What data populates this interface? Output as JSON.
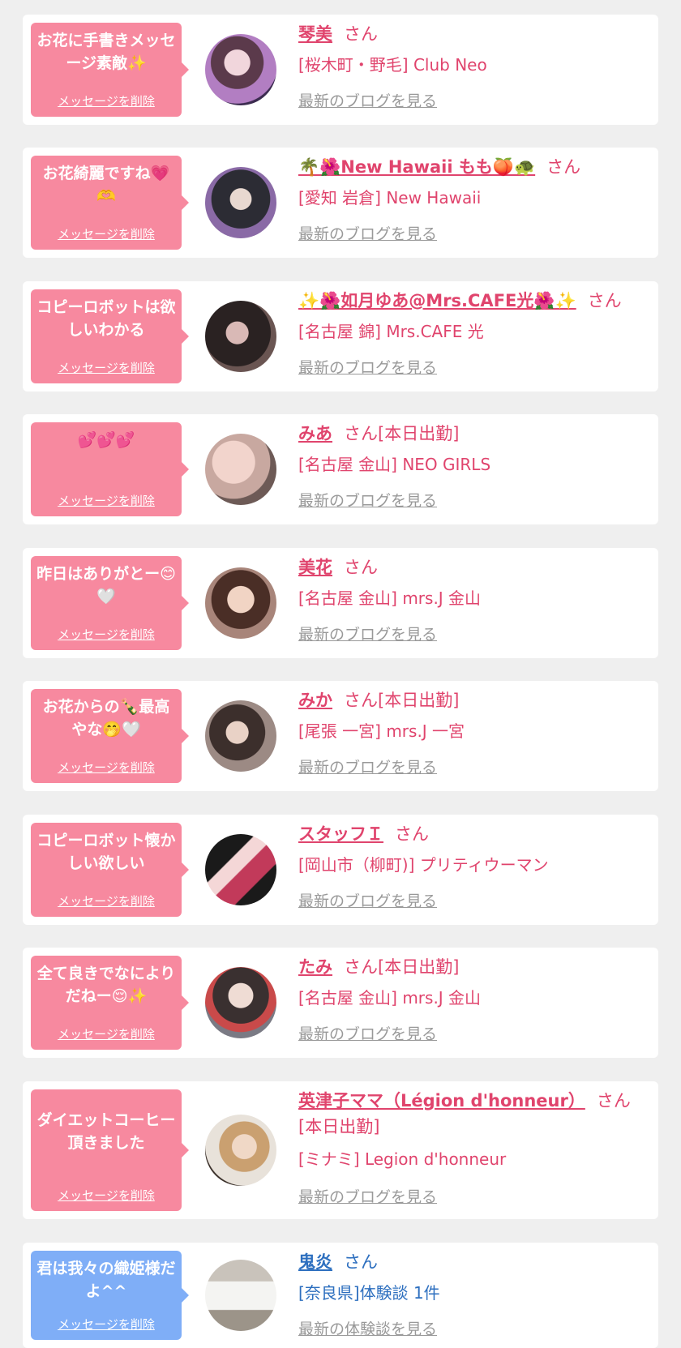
{
  "delete_label": "メッセージを削除",
  "san": "さん",
  "colors": {
    "pink": "#f7899f",
    "blue": "#7faef7",
    "name_pink": "#e0446d",
    "name_blue": "#2d6fbf",
    "page_bg": "#efefef"
  },
  "messages": [
    {
      "message": "お花に手書きメッセージ素敵✨",
      "name": "琴美",
      "san_suffix": "",
      "shop": "[桜木町・野毛] Club Neo",
      "blog": "最新のブログを見る",
      "color": "pink"
    },
    {
      "message": "お花綺麗ですね💗🫶",
      "name": "🌴🌺New Hawaii もも🍑🐢",
      "san_suffix": "",
      "shop": "[愛知 岩倉] New Hawaii",
      "blog": "最新のブログを見る",
      "color": "pink"
    },
    {
      "message": "コピーロボットは欲しいわかる",
      "name": "✨🌺如月ゆあ@Mrs.CAFE光🌺✨",
      "san_suffix": "",
      "shop": "[名古屋 錦] Mrs.CAFE 光",
      "blog": "最新のブログを見る",
      "color": "pink"
    },
    {
      "message": "💕💕💕",
      "name": "みあ",
      "san_suffix": "[本日出勤]",
      "shop": "[名古屋 金山] NEO GIRLS",
      "blog": "最新のブログを見る",
      "color": "pink"
    },
    {
      "message": "昨日はありがとー😊🤍",
      "name": "美花",
      "san_suffix": "",
      "shop": "[名古屋 金山] mrs.J 金山",
      "blog": "最新のブログを見る",
      "color": "pink"
    },
    {
      "message": "お花からの🍾最高やな🤭🤍",
      "name": "みか",
      "san_suffix": "[本日出勤]",
      "shop": "[尾張 一宮] mrs.J 一宮",
      "blog": "最新のブログを見る",
      "color": "pink"
    },
    {
      "message": "コピーロボット懐かしい欲しい",
      "name": "スタッフＩ",
      "san_suffix": "",
      "shop": "[岡山市（柳町)] プリティウーマン",
      "blog": "最新のブログを見る",
      "color": "pink"
    },
    {
      "message": "全て良きでなによりだねー😌✨",
      "name": "たみ",
      "san_suffix": "[本日出勤]",
      "shop": "[名古屋 金山] mrs.J 金山",
      "blog": "最新のブログを見る",
      "color": "pink"
    },
    {
      "message": "ダイエットコーヒー頂きました",
      "name": "英津子ママ（Légion d'honneur）",
      "san_suffix": "[本日出勤]",
      "shop": "[ミナミ] Legion d'honneur",
      "blog": "最新のブログを見る",
      "color": "pink"
    },
    {
      "message": "君は我々の織姫様だよ^^",
      "name": "鬼炎",
      "san_suffix": "",
      "shop": "[奈良県]体験談 1件",
      "blog": "最新の体験談を見る",
      "color": "blue"
    }
  ]
}
